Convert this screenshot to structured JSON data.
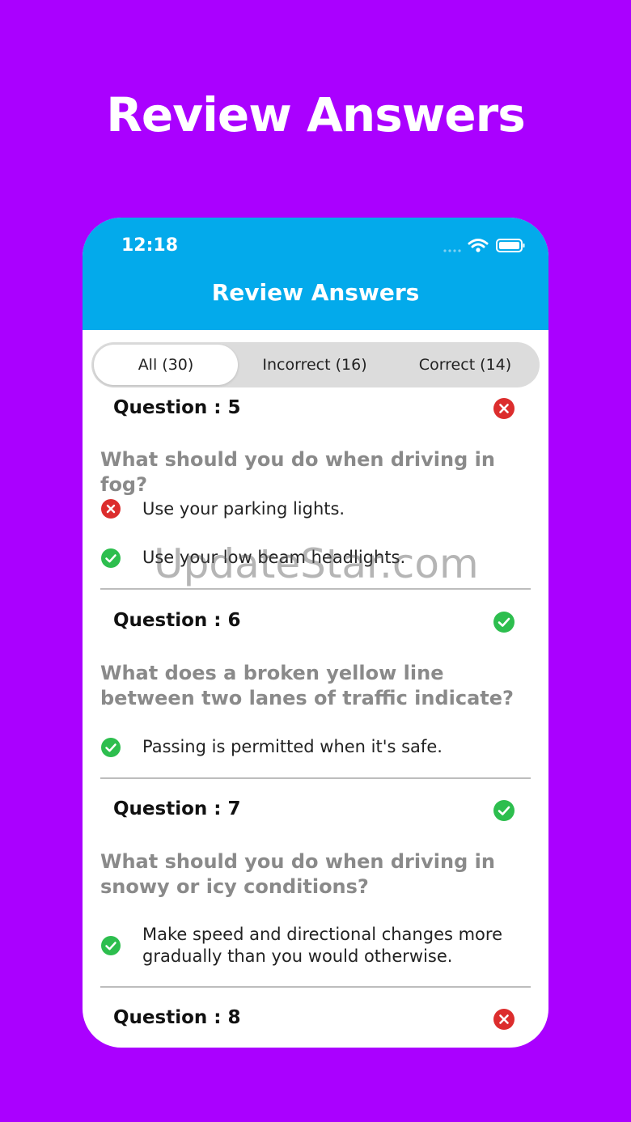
{
  "promo": {
    "title": "Review Answers"
  },
  "status_bar": {
    "time": "12:18"
  },
  "nav": {
    "title": "Review Answers"
  },
  "tabs": [
    {
      "label": "All (30)",
      "active": true
    },
    {
      "label": "Incorrect (16)",
      "active": false
    },
    {
      "label": "Correct (14)",
      "active": false
    }
  ],
  "questions": [
    {
      "header": "Question : 5",
      "status": "incorrect",
      "text": "What should you do when driving in fog?",
      "answers": [
        {
          "text": "Use your parking lights.",
          "status": "incorrect"
        },
        {
          "text": "Use your low beam headlights.",
          "status": "correct"
        }
      ]
    },
    {
      "header": "Question : 6",
      "status": "correct",
      "text": "What does a broken yellow line between two lanes of traffic indicate?",
      "answers": [
        {
          "text": "Passing is permitted when it's safe.",
          "status": "correct"
        }
      ]
    },
    {
      "header": "Question : 7",
      "status": "correct",
      "text": "What should you do when driving in snowy or icy conditions?",
      "answers": [
        {
          "text": "Make speed and directional changes more gradually than you would otherwise.",
          "status": "correct"
        }
      ]
    },
    {
      "header": "Question : 8",
      "status": "incorrect"
    }
  ],
  "watermark": "UpdateStar.com",
  "colors": {
    "background": "#aa00ff",
    "nav": "#03aaeb",
    "correct": "#2dbe4e",
    "incorrect": "#dc2d2d"
  }
}
